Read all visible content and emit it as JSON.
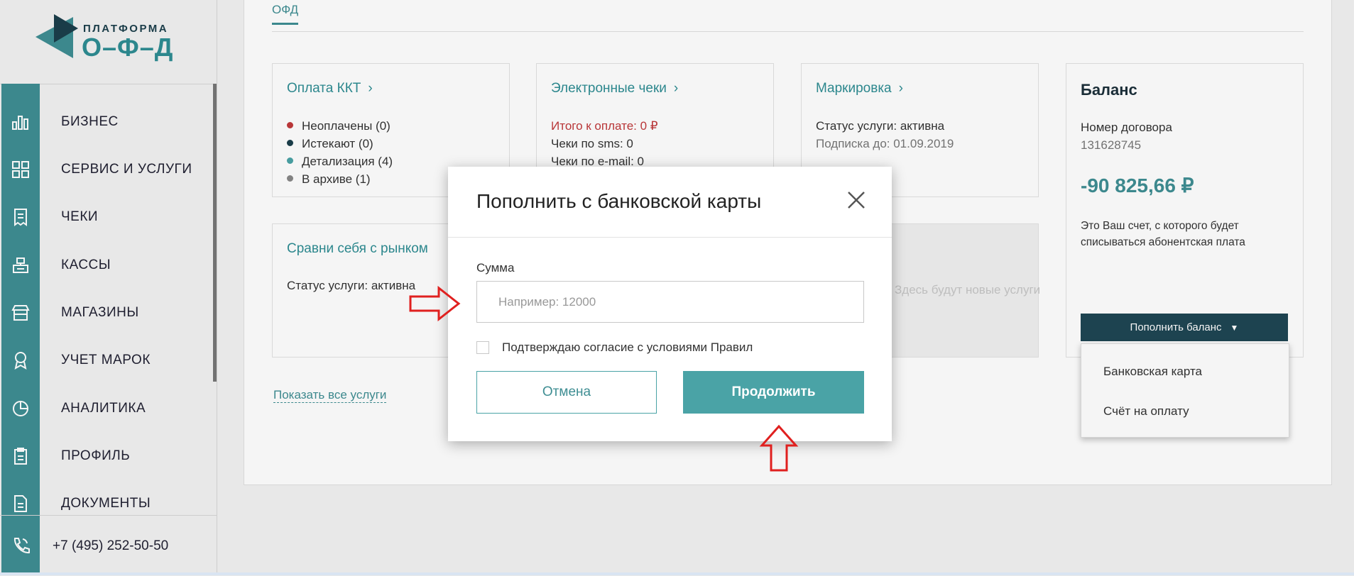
{
  "logo": {
    "top": "ПЛАТФОРМА",
    "main": "О–Ф–Д"
  },
  "nav": [
    {
      "label": "БИЗНЕС",
      "icon": "bar-chart-icon"
    },
    {
      "label": "СЕРВИС И УСЛУГИ",
      "icon": "grid-icon"
    },
    {
      "label": "ЧЕКИ",
      "icon": "receipt-icon"
    },
    {
      "label": "КАССЫ",
      "icon": "cash-register-icon"
    },
    {
      "label": "МАГАЗИНЫ",
      "icon": "store-icon"
    },
    {
      "label": "УЧЕТ МАРОК",
      "icon": "badge-icon"
    },
    {
      "label": "АНАЛИТИКА",
      "icon": "pie-chart-icon"
    },
    {
      "label": "ПРОФИЛЬ",
      "icon": "clipboard-icon"
    },
    {
      "label": "ДОКУМЕНТЫ",
      "icon": "document-icon"
    }
  ],
  "phone": "+7 (495) 252-50-50",
  "tabs": {
    "active": "ОФД"
  },
  "cards": {
    "kkt": {
      "title": "Оплата ККТ",
      "items": [
        {
          "text": "Неоплачены (0)",
          "color": "#c0393b"
        },
        {
          "text": "Истекают (0)",
          "color": "#1c3f4b"
        },
        {
          "text": "Детализация (4)",
          "color": "#4aa3a6"
        },
        {
          "text": "В архиве (1)",
          "color": "#888888"
        }
      ]
    },
    "receipts": {
      "title": "Электронные чеки",
      "total": "Итого к оплате: 0 ₽",
      "sms": "Чеки по sms: 0",
      "email": "Чеки по e-mail: 0"
    },
    "marking": {
      "title": "Маркировка",
      "status": "Статус услуги: активна",
      "subscription": "Подписка до: 01.09.2019"
    },
    "compare": {
      "title": "Сравни себя с рынком",
      "status": "Статус услуги: активна"
    },
    "future": {
      "text": "Здесь будут новые услуги"
    }
  },
  "show_all": "Показать все услуги",
  "balance": {
    "title": "Баланс",
    "contract_label": "Номер договора",
    "contract_number": "131628745",
    "amount": "-90 825,66 ₽",
    "note": "Это Ваш счет, с которого будет списываться абонентская плата",
    "topup_label": "Пополнить баланс",
    "dropdown": [
      "Банковская карта",
      "Счёт на оплату"
    ]
  },
  "modal": {
    "title": "Пополнить с банковской карты",
    "amount_label": "Сумма",
    "amount_placeholder": "Например: 12000",
    "amount_value": "",
    "consent": "Подтверждаю согласие с условиями Правил",
    "cancel": "Отмена",
    "continue": "Продолжить"
  },
  "colors": {
    "accent": "#4aa3a6",
    "dark": "#1f4654",
    "arrow": "#e0201f"
  }
}
